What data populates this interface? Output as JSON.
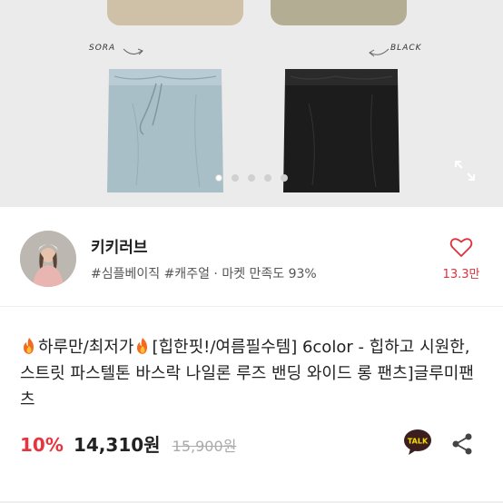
{
  "gallery": {
    "labels": [
      "SORA",
      "BLACK"
    ],
    "slide_count": 5,
    "active_slide": 1
  },
  "shop": {
    "name": "키키러브",
    "tags": "#심플베이직 #캐주얼",
    "separator": "·",
    "satisfaction": "마켓 만족도 93%",
    "like_count": "13.3만"
  },
  "product": {
    "title_part1": "하루만/최저가",
    "title_part2": "[힙한핏!/여름필수템] 6color - 힙하고 시원한, 스트릿 파스텔톤 바스락 나일론 루즈 밴딩 와이드 롱 팬츠]글루미팬츠",
    "discount": "10%",
    "price": "14,310원",
    "original_price": "15,900원"
  },
  "talk_badge": "TALK",
  "colors": {
    "accent_red": "#e8343d",
    "sora": "#a9bfc8",
    "black": "#1c1c1c",
    "talk_yellow": "#fae100"
  }
}
